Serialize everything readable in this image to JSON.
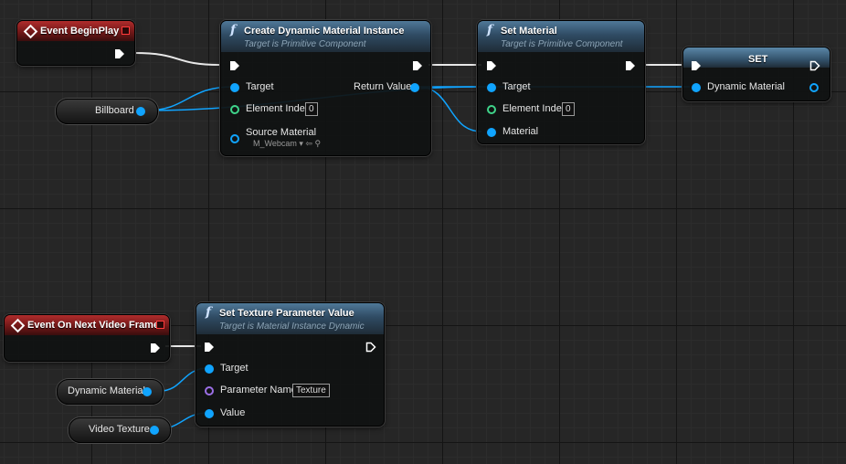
{
  "colors": {
    "exec": "#ffffff",
    "object_pin": "#10a4ff",
    "int_pin": "#3fd48a",
    "name_pin": "#9b6fe6",
    "event_header": "#9b2121",
    "function_header": "#4f7898"
  },
  "nodes": {
    "begin_play": {
      "title": "Event BeginPlay",
      "icon": "event-diamond-icon"
    },
    "create_dmi": {
      "title": "Create Dynamic Material Instance",
      "subtitle": "Target is Primitive Component",
      "target": "Target",
      "element_index": "Element Index",
      "element_index_value": "0",
      "source_material": "Source Material",
      "source_material_value": "M_Webcam",
      "return_value": "Return Value"
    },
    "set_material": {
      "title": "Set Material",
      "subtitle": "Target is Primitive Component",
      "target": "Target",
      "element_index": "Element Index",
      "element_index_value": "0",
      "material": "Material"
    },
    "set_var": {
      "title": "SET",
      "pin": "Dynamic Material"
    },
    "next_frame": {
      "title": "Event On Next Video Frame",
      "icon": "event-diamond-icon"
    },
    "set_texture_param": {
      "title": "Set Texture Parameter Value",
      "subtitle": "Target is Material Instance Dynamic",
      "target": "Target",
      "param_name": "Parameter Name",
      "param_name_value": "Texture",
      "value": "Value"
    },
    "billboard": {
      "label": "Billboard"
    },
    "dynamic_material_get": {
      "label": "Dynamic Material"
    },
    "video_texture_get": {
      "label": "Video Texture"
    }
  }
}
